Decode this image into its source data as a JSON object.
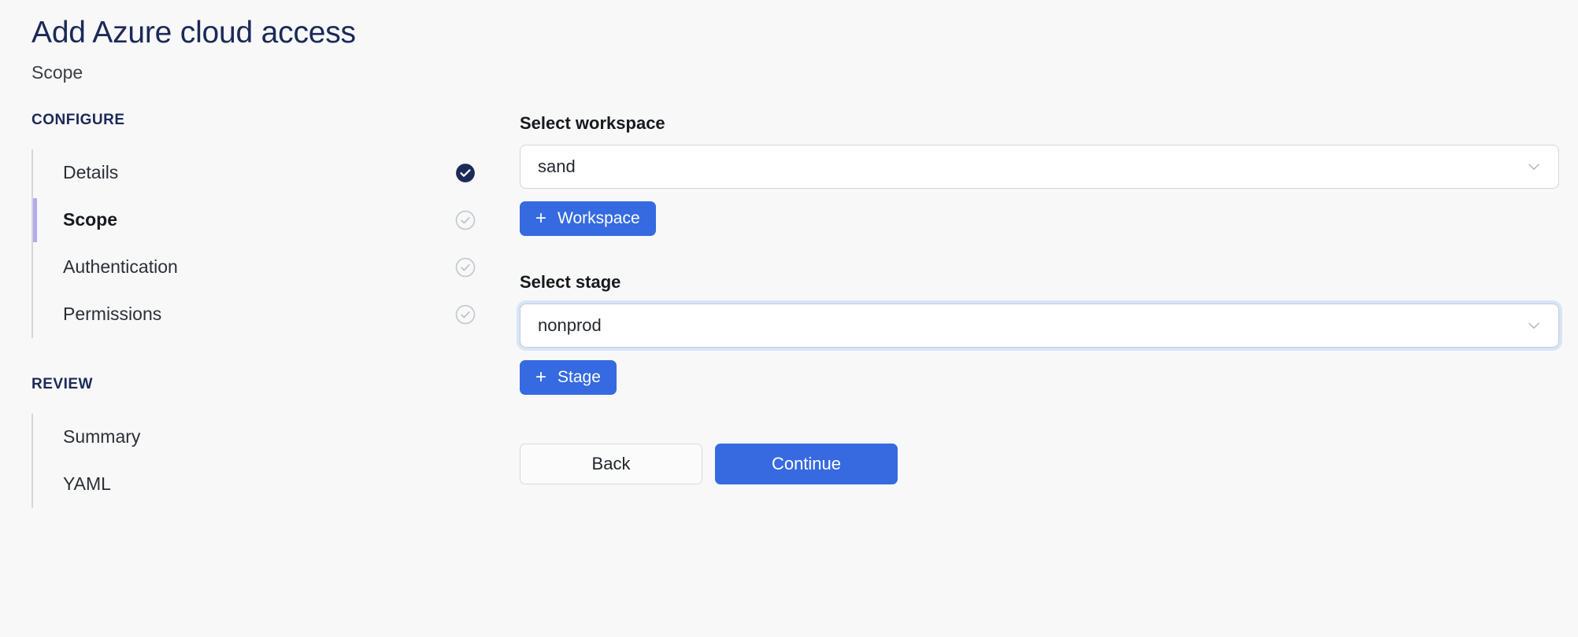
{
  "header": {
    "title": "Add Azure cloud access",
    "subtitle": "Scope"
  },
  "sidebar": {
    "configure": {
      "section_label": "CONFIGURE",
      "steps": [
        {
          "label": "Details",
          "state": "complete",
          "icon": "check-circle-filled-icon"
        },
        {
          "label": "Scope",
          "state": "active",
          "icon": "check-circle-outline-icon"
        },
        {
          "label": "Authentication",
          "state": "pending",
          "icon": "check-circle-outline-icon"
        },
        {
          "label": "Permissions",
          "state": "pending",
          "icon": "check-circle-outline-icon"
        }
      ]
    },
    "review": {
      "section_label": "REVIEW",
      "steps": [
        {
          "label": "Summary",
          "state": "pending",
          "icon": "none"
        },
        {
          "label": "YAML",
          "state": "pending",
          "icon": "none"
        }
      ]
    }
  },
  "main": {
    "workspace": {
      "label": "Select workspace",
      "value": "sand",
      "placeholder": "Select workspace",
      "chevron_icon": "chevron-down-icon",
      "add_button": {
        "plus_icon": "plus-icon",
        "label": "Workspace"
      }
    },
    "stage": {
      "label": "Select stage",
      "value": "nonprod",
      "placeholder": "Select stage",
      "chevron_icon": "chevron-down-icon",
      "add_button": {
        "plus_icon": "plus-icon",
        "label": "Stage"
      }
    },
    "actions": {
      "back_label": "Back",
      "continue_label": "Continue"
    }
  },
  "colors": {
    "background": "#f8f8f9",
    "title_navy": "#1b2a57",
    "primary_blue": "#376ae1",
    "active_step_bar": "#b3a9f0",
    "complete_step": "#1b2a57",
    "pending_step": "#c3c7d0",
    "rail": "#d4d6da",
    "focus_ring": "#d9e5f5"
  }
}
